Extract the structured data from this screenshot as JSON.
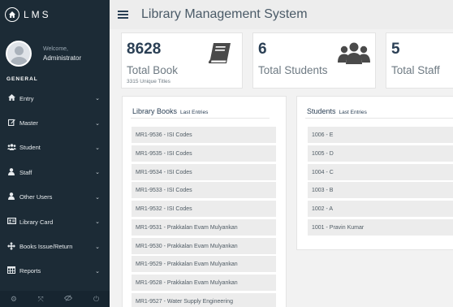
{
  "brand": {
    "name": "LMS",
    "icon": "home-icon"
  },
  "profile": {
    "welcome": "Welcome,",
    "name": "Administrator"
  },
  "sidebar": {
    "section": "GENERAL",
    "items": [
      {
        "label": "Entry",
        "icon": "home-icon"
      },
      {
        "label": "Master",
        "icon": "edit-icon"
      },
      {
        "label": "Student",
        "icon": "users-icon"
      },
      {
        "label": "Staff",
        "icon": "user-icon"
      },
      {
        "label": "Other Users",
        "icon": "user-icon"
      },
      {
        "label": "Library Card",
        "icon": "id-card-icon"
      },
      {
        "label": "Books Issue/Return",
        "icon": "arrows-icon"
      },
      {
        "label": "Reports",
        "icon": "table-icon"
      }
    ],
    "footer_icons": [
      "settings-icon",
      "fullscreen-icon",
      "hide-icon",
      "power-icon"
    ]
  },
  "topbar": {
    "title": "Library Management System"
  },
  "stats": [
    {
      "value": "8628",
      "label": "Total Book",
      "sub": "3315 Unique Titles",
      "icon": "book-icon"
    },
    {
      "value": "6",
      "label": "Total Students",
      "icon": "users-icon"
    },
    {
      "value": "5",
      "label": "Total Staff"
    }
  ],
  "books_panel": {
    "title": "Library Books",
    "subtitle": "Last Entries",
    "items": [
      "MR1-9536 - ISI Codes",
      "MR1-9535 - ISI Codes",
      "MR1-9534 - ISI Codes",
      "MR1-9533 - ISI Codes",
      "MR1-9532 - ISI Codes",
      "MR1-9531 - Prakkalan Evam Mulyankan",
      "MR1-9530 - Prakkalan Evam Mulyankan",
      "MR1-9529 - Prakkalan Evam Mulyankan",
      "MR1-9528 - Prakkalan Evam Mulyankan",
      "MR1-9527 - Water Supply Engineering"
    ]
  },
  "students_panel": {
    "title": "Students",
    "subtitle": "Last Entries",
    "items": [
      "1006 - E",
      "1005 - D",
      "1004 - C",
      "1003 - B",
      "1002 - A",
      "1001 - Pravin Kumar"
    ]
  }
}
